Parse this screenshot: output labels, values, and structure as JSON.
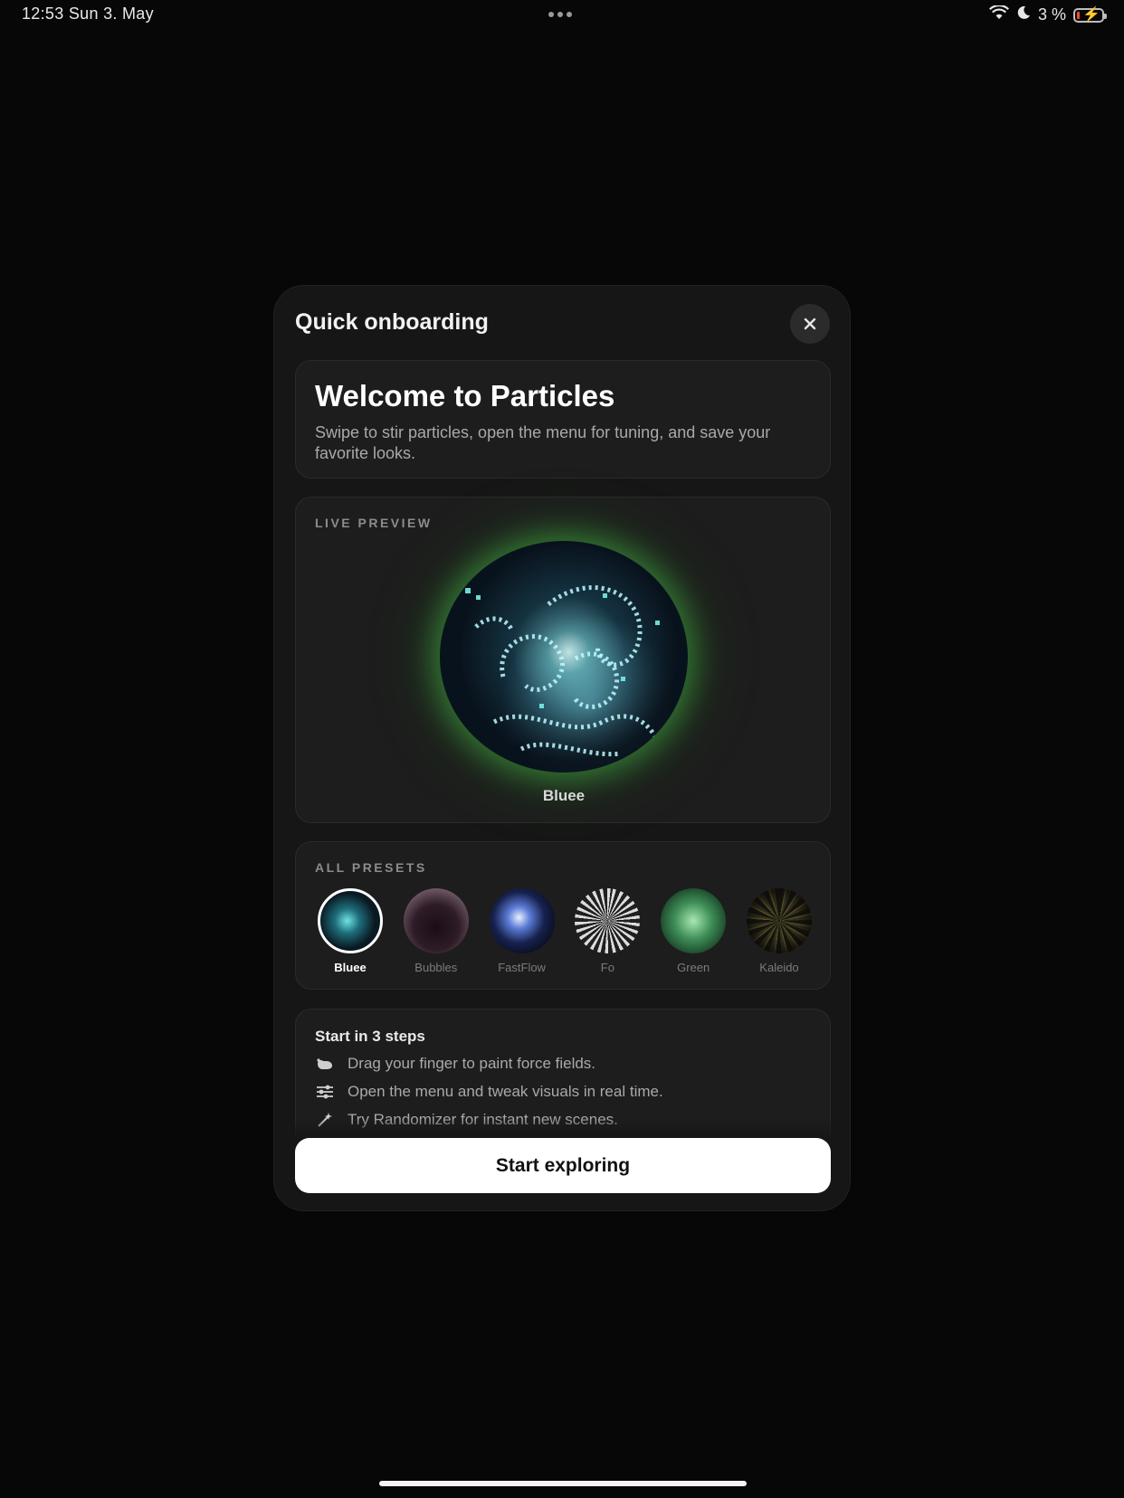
{
  "status_bar": {
    "time_date": "12:53   Sun 3. May",
    "battery_percent": "3 %",
    "icons": [
      "wifi-icon",
      "moon-icon",
      "battery-charging-icon"
    ]
  },
  "modal": {
    "title": "Quick onboarding",
    "close_icon": "close-icon",
    "welcome": {
      "heading": "Welcome to Particles",
      "body": "Swipe to stir particles, open the menu for tuning, and save your favorite looks."
    },
    "preview": {
      "label": "LIVE PREVIEW",
      "preset_name": "Bluee"
    },
    "presets": {
      "label": "ALL PRESETS",
      "selected": "Bluee",
      "items": [
        {
          "name": "Bluee"
        },
        {
          "name": "Bubbles"
        },
        {
          "name": "FastFlow"
        },
        {
          "name": "Fo"
        },
        {
          "name": "Green"
        },
        {
          "name": "Kaleido"
        }
      ]
    },
    "steps": {
      "heading": "Start in 3 steps",
      "items": [
        {
          "icon": "hand-drag-icon",
          "text": "Drag your finger to paint force fields."
        },
        {
          "icon": "sliders-icon",
          "text": "Open the menu and tweak visuals in real time."
        },
        {
          "icon": "magic-wand-icon",
          "text": "Try Randomizer for instant new scenes."
        }
      ]
    },
    "cta_label": "Start exploring"
  },
  "colors": {
    "background": "#070707",
    "modal": "#161616",
    "card": "#1d1d1d",
    "glow": "#46be46",
    "cta": "#ffffff"
  }
}
